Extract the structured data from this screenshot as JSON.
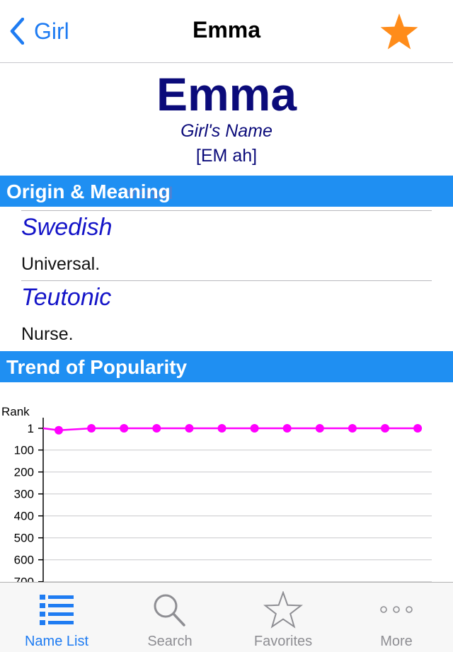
{
  "nav": {
    "back_label": "Girl",
    "title": "Emma"
  },
  "name": {
    "display": "Emma",
    "gender": "Girl's Name",
    "pronunciation": "[EM ah]"
  },
  "sections": {
    "origin_title": "Origin & Meaning",
    "origin_ghost_text": "versal",
    "trend_title": "Trend of Popularity"
  },
  "origins": [
    {
      "language": "Swedish",
      "meaning": "Universal."
    },
    {
      "language": "Teutonic",
      "meaning": "Nurse."
    }
  ],
  "colors": {
    "accent": "#1f8ff2",
    "series": "#ff00ff",
    "title_navy": "#0b0b7a",
    "star": "#ff8c1a"
  },
  "chart_data": {
    "type": "line",
    "ylabel": "Rank",
    "y_ticks": [
      "1",
      "100",
      "200",
      "300",
      "400",
      "500",
      "600",
      "700"
    ],
    "y_tick_values": [
      1,
      100,
      200,
      300,
      400,
      500,
      600,
      700
    ],
    "ylim": [
      1,
      700
    ],
    "y_inverted": true,
    "grid": true,
    "series": [
      {
        "values": [
          10,
          1,
          1,
          1,
          1,
          1,
          1,
          1,
          1,
          1,
          1,
          1
        ]
      }
    ],
    "leading_segment_start": 1
  },
  "tabs": [
    {
      "label": "Name List",
      "icon": "list-icon",
      "active": true
    },
    {
      "label": "Search",
      "icon": "search-icon",
      "active": false
    },
    {
      "label": "Favorites",
      "icon": "star-outline-icon",
      "active": false
    },
    {
      "label": "More",
      "icon": "more-icon",
      "active": false
    }
  ]
}
